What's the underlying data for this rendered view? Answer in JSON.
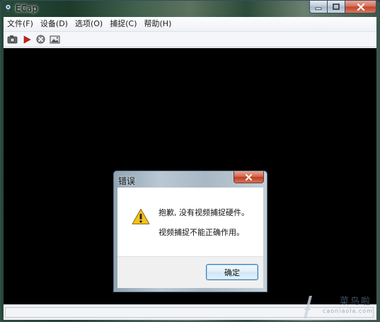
{
  "window": {
    "title": "ECap",
    "icon": "webcam-icon"
  },
  "menubar": {
    "items": [
      {
        "label": "文件(F)"
      },
      {
        "label": "设备(D)"
      },
      {
        "label": "选项(O)"
      },
      {
        "label": "捕捉(C)"
      },
      {
        "label": "帮助(H)"
      }
    ]
  },
  "toolbar": {
    "buttons": [
      {
        "icon": "camera-icon"
      },
      {
        "icon": "play-icon"
      },
      {
        "icon": "stop-icon"
      },
      {
        "icon": "image-icon"
      }
    ]
  },
  "dialog": {
    "title": "错误",
    "message_line1": "抱歉, 没有视频捕捉硬件。",
    "message_line2": "视频捕捉不能正确作用。",
    "ok_label": "确定",
    "icon": "warning-icon"
  },
  "watermark": {
    "text": "菜鸟啦",
    "subtext": "caoniaola.com"
  },
  "colors": {
    "video_background": "#000000",
    "close_button": "#c0452b",
    "ok_button_border": "#3c7fb1",
    "warning_yellow": "#f2c21b"
  }
}
